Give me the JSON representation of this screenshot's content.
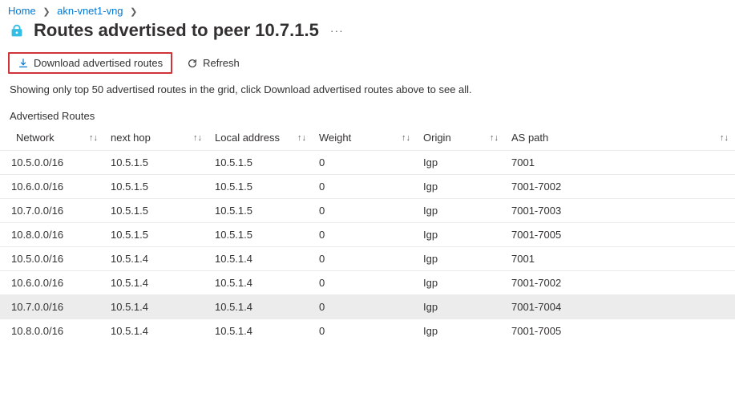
{
  "breadcrumb": {
    "home": "Home",
    "item1": "akn-vnet1-vng"
  },
  "page": {
    "title": "Routes advertised to peer 10.7.1.5"
  },
  "toolbar": {
    "download_label": "Download advertised routes",
    "refresh_label": "Refresh"
  },
  "info_text": "Showing only top 50 advertised routes in the grid, click Download advertised routes above to see all.",
  "section_title": "Advertised Routes",
  "columns": {
    "network": "Network",
    "next_hop": "next hop",
    "local_address": "Local address",
    "weight": "Weight",
    "origin": "Origin",
    "as_path": "AS path"
  },
  "rows": [
    {
      "network": "10.5.0.0/16",
      "next_hop": "10.5.1.5",
      "local_address": "10.5.1.5",
      "weight": "0",
      "origin": "Igp",
      "as_path": "7001"
    },
    {
      "network": "10.6.0.0/16",
      "next_hop": "10.5.1.5",
      "local_address": "10.5.1.5",
      "weight": "0",
      "origin": "Igp",
      "as_path": "7001-7002"
    },
    {
      "network": "10.7.0.0/16",
      "next_hop": "10.5.1.5",
      "local_address": "10.5.1.5",
      "weight": "0",
      "origin": "Igp",
      "as_path": "7001-7003"
    },
    {
      "network": "10.8.0.0/16",
      "next_hop": "10.5.1.5",
      "local_address": "10.5.1.5",
      "weight": "0",
      "origin": "Igp",
      "as_path": "7001-7005"
    },
    {
      "network": "10.5.0.0/16",
      "next_hop": "10.5.1.4",
      "local_address": "10.5.1.4",
      "weight": "0",
      "origin": "Igp",
      "as_path": "7001"
    },
    {
      "network": "10.6.0.0/16",
      "next_hop": "10.5.1.4",
      "local_address": "10.5.1.4",
      "weight": "0",
      "origin": "Igp",
      "as_path": "7001-7002"
    },
    {
      "network": "10.7.0.0/16",
      "next_hop": "10.5.1.4",
      "local_address": "10.5.1.4",
      "weight": "0",
      "origin": "Igp",
      "as_path": "7001-7004",
      "hover": true
    },
    {
      "network": "10.8.0.0/16",
      "next_hop": "10.5.1.4",
      "local_address": "10.5.1.4",
      "weight": "0",
      "origin": "Igp",
      "as_path": "7001-7005"
    }
  ]
}
